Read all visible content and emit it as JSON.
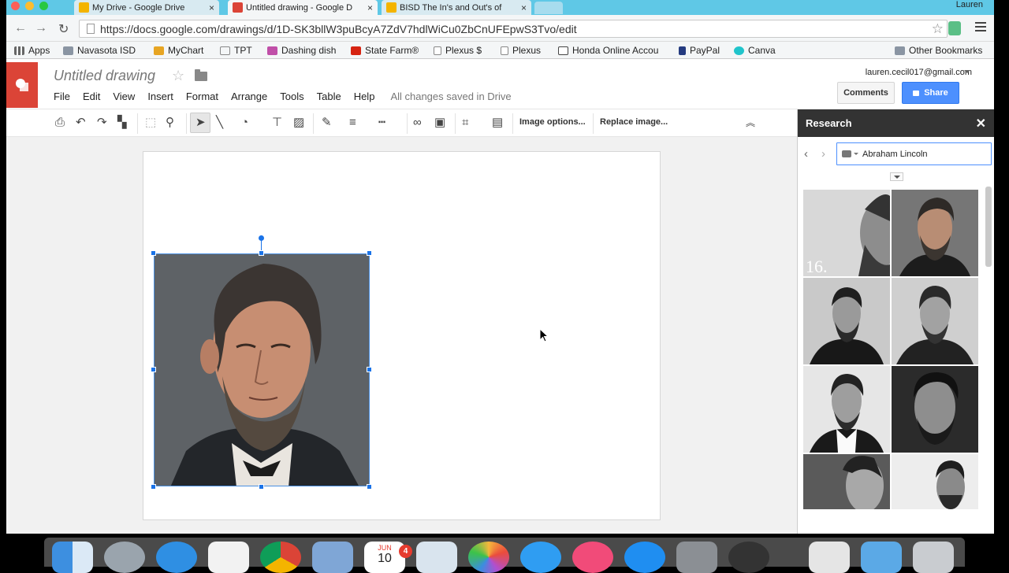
{
  "browser": {
    "tabs": [
      {
        "title": "My Drive - Google Drive",
        "favicon_color": "#f4b400"
      },
      {
        "title": "Untitled drawing - Google D",
        "favicon_color": "#db4437"
      },
      {
        "title": "BISD The In's and Out's of",
        "favicon_color": "#f4b400"
      }
    ],
    "profile_name": "Lauren",
    "url": "https://docs.google.com/drawings/d/1D-SK3bllW3puBcyA7ZdV7hdlWiCu0ZbCnUFEpwS3Tvo/edit",
    "bookmarks": [
      {
        "label": "Apps",
        "icon": "apps-grid-icon"
      },
      {
        "label": "Navasota ISD",
        "icon": "folder-icon"
      },
      {
        "label": "MyChart",
        "icon": "mychart-icon"
      },
      {
        "label": "TPT",
        "icon": "tpt-icon"
      },
      {
        "label": "Dashing dish",
        "icon": "dashing-dish-icon"
      },
      {
        "label": "State Farm®",
        "icon": "state-farm-icon"
      },
      {
        "label": "Plexus $",
        "icon": "page-icon"
      },
      {
        "label": "Plexus",
        "icon": "page-icon"
      },
      {
        "label": "Honda Online Accou",
        "icon": "honda-icon"
      },
      {
        "label": "PayPal",
        "icon": "paypal-icon"
      },
      {
        "label": "Canva",
        "icon": "canva-icon"
      },
      {
        "label": "Other Bookmarks",
        "icon": "folder-icon"
      }
    ]
  },
  "doc": {
    "title": "Untitled drawing",
    "menu": [
      "File",
      "Edit",
      "View",
      "Insert",
      "Format",
      "Arrange",
      "Tools",
      "Table",
      "Help"
    ],
    "save_status": "All changes saved in Drive",
    "account": "lauren.cecil017@gmail.com",
    "comments_label": "Comments",
    "share_label": "Share",
    "accent_color": "#4d90fe",
    "brand_color": "#db4437"
  },
  "toolbar": {
    "image_options_label": "Image options...",
    "replace_image_label": "Replace image...",
    "icons": [
      "print-icon",
      "undo-icon",
      "redo-icon",
      "paint-format-icon",
      "zoom-fit-icon",
      "zoom-icon",
      "select-icon",
      "line-icon",
      "shape-icon",
      "text-box-icon",
      "image-icon",
      "line-color-icon",
      "line-weight-icon",
      "line-dash-icon",
      "link-icon",
      "comment-icon",
      "crop-icon",
      "mask-image-icon",
      "collapse-icon"
    ]
  },
  "research": {
    "title": "Research",
    "query": "Abraham Lincoln",
    "result_caption": "16."
  },
  "dock": {
    "calendar_month": "JUN",
    "calendar_day": "10",
    "notification_count": "4"
  }
}
